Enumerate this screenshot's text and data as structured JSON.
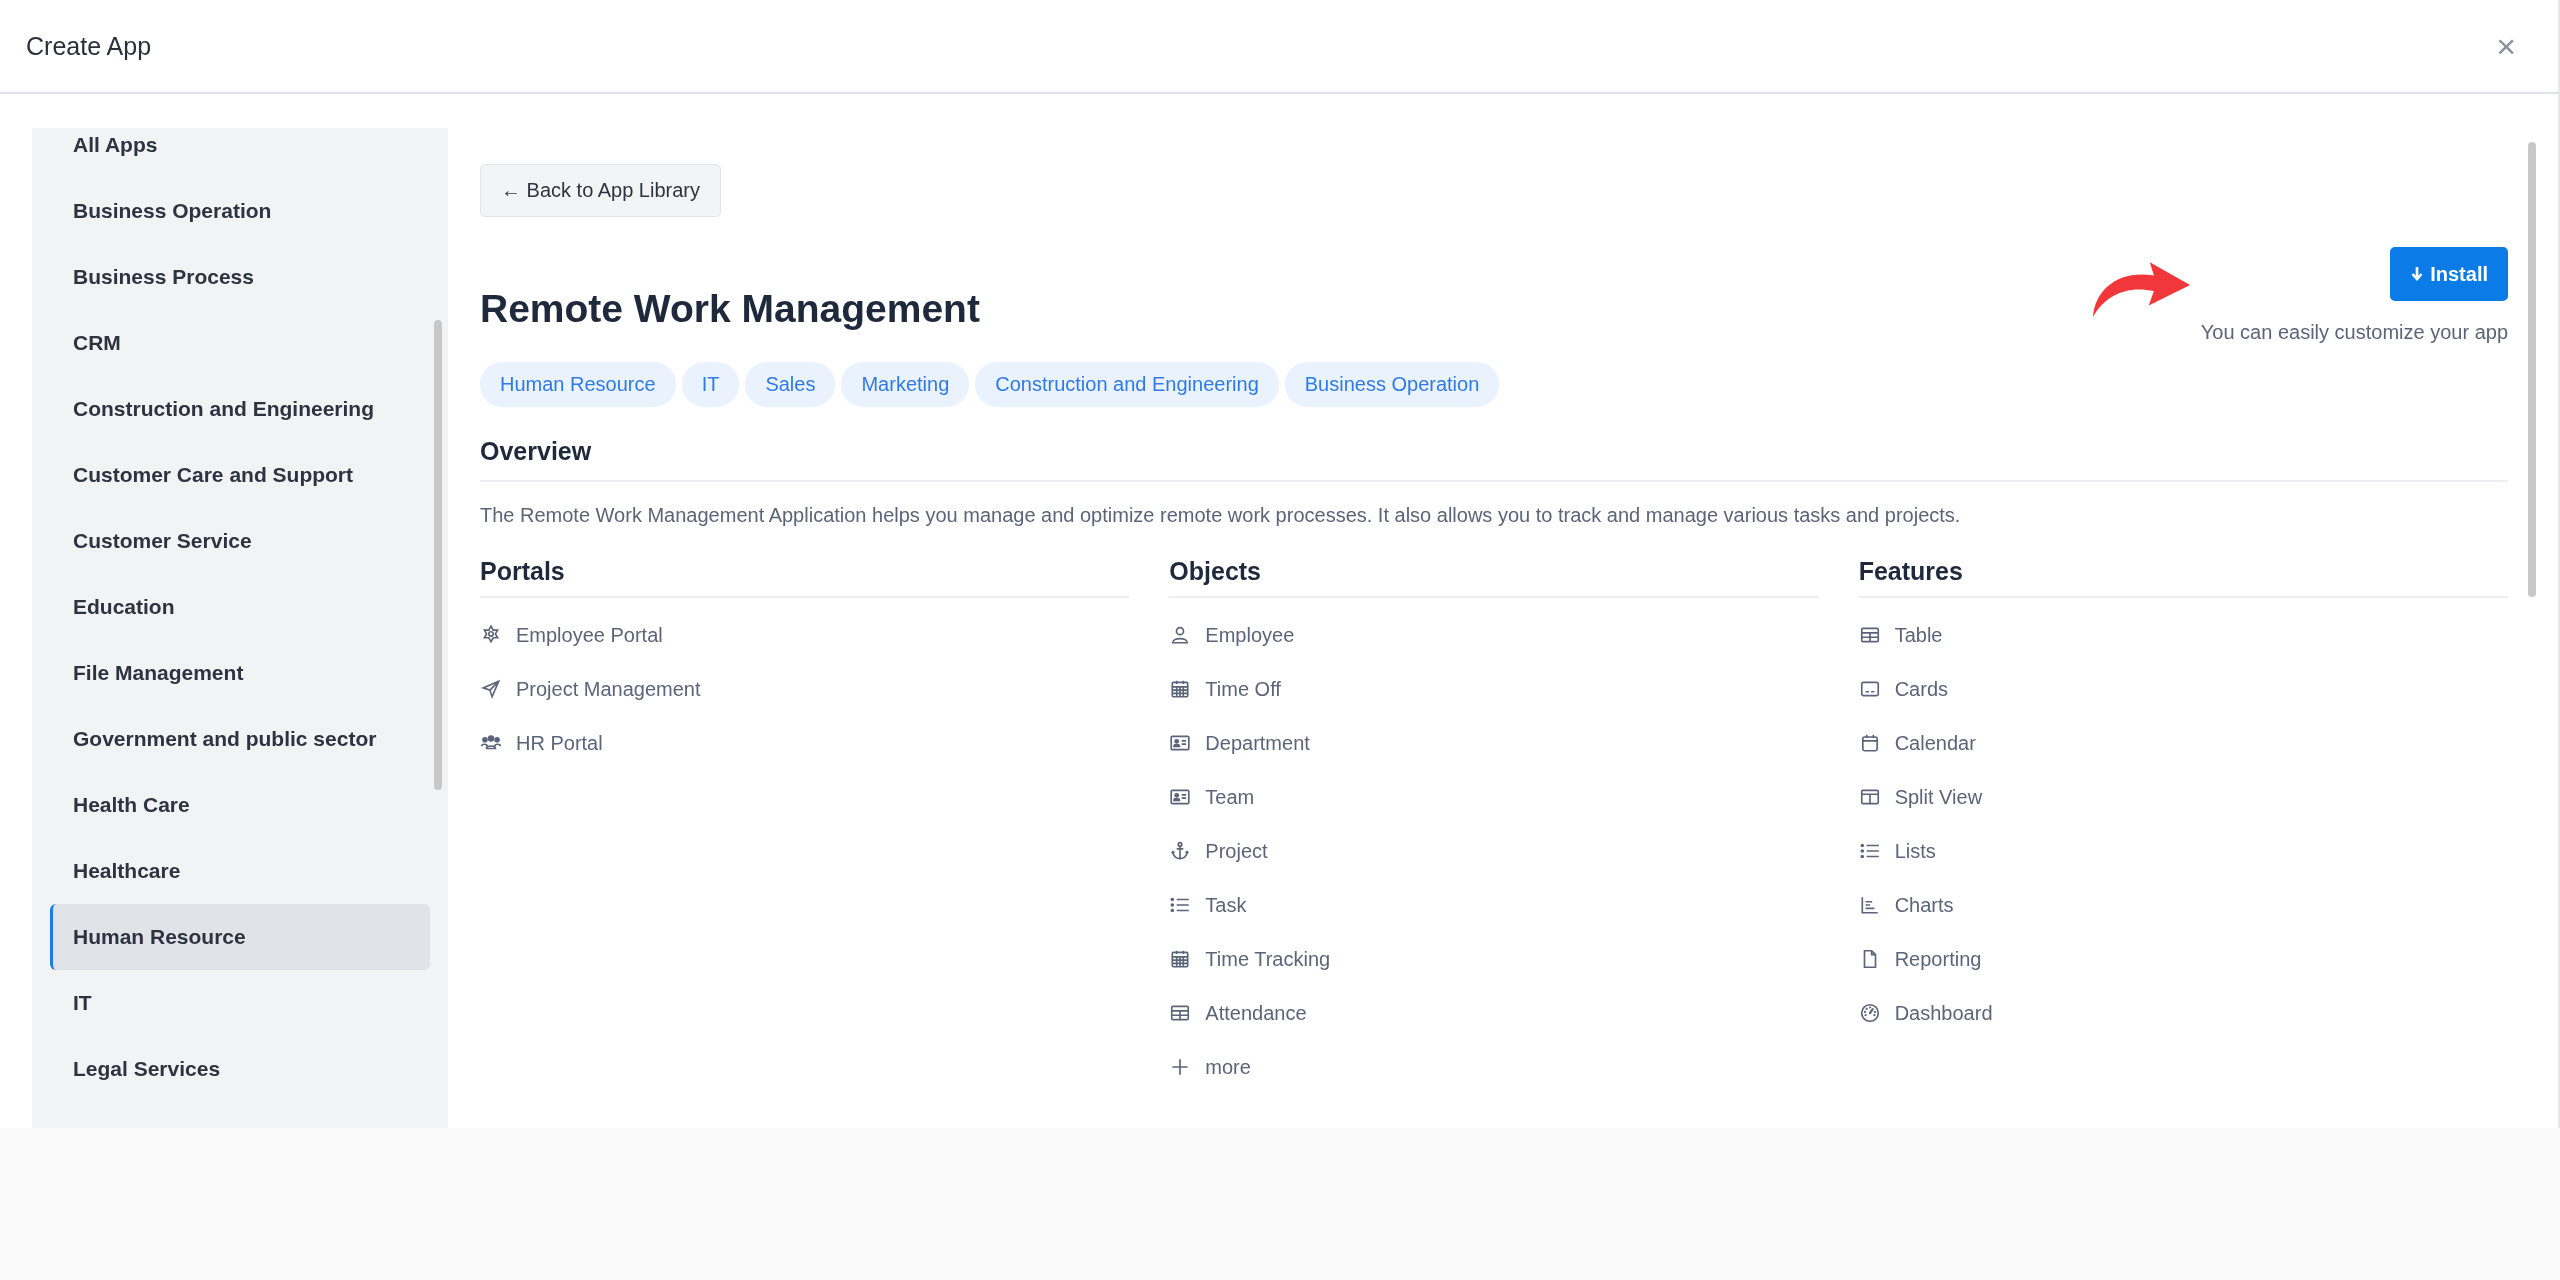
{
  "window": {
    "title": "Create App",
    "close": "×"
  },
  "sidebar": {
    "items": [
      {
        "label": "All Apps",
        "selected": false
      },
      {
        "label": "Business Operation",
        "selected": false
      },
      {
        "label": "Business Process",
        "selected": false
      },
      {
        "label": "CRM",
        "selected": false
      },
      {
        "label": "Construction and Engineering",
        "selected": false
      },
      {
        "label": "Customer Care and Support",
        "selected": false
      },
      {
        "label": "Customer Service",
        "selected": false
      },
      {
        "label": "Education",
        "selected": false
      },
      {
        "label": "File Management",
        "selected": false
      },
      {
        "label": "Government and public sector",
        "selected": false
      },
      {
        "label": "Health Care",
        "selected": false
      },
      {
        "label": "Healthcare",
        "selected": false
      },
      {
        "label": "Human Resource",
        "selected": true
      },
      {
        "label": "IT",
        "selected": false
      },
      {
        "label": "Legal Services",
        "selected": false
      }
    ]
  },
  "back_button": "← Back to App Library",
  "app": {
    "title": "Remote Work Management",
    "install_button": "Install",
    "install_hint": "You can easily customize your app",
    "tags": [
      "Human Resource",
      "IT",
      "Sales",
      "Marketing",
      "Construction and Engineering",
      "Business Operation"
    ],
    "overview": {
      "heading": "Overview",
      "text": "The Remote Work Management Application helps you manage and optimize remote work processes. It also allows you to track and manage various tasks and projects."
    },
    "portals": {
      "heading": "Portals",
      "items": [
        "Employee Portal",
        "Project Management",
        "HR Portal"
      ]
    },
    "objects": {
      "heading": "Objects",
      "items": [
        "Employee",
        "Time Off",
        "Department",
        "Team",
        "Project",
        "Task",
        "Time Tracking",
        "Attendance"
      ],
      "more": "more"
    },
    "features": {
      "heading": "Features",
      "items": [
        "Table",
        "Cards",
        "Calendar",
        "Split View",
        "Lists",
        "Charts",
        "Reporting",
        "Dashboard"
      ]
    }
  }
}
